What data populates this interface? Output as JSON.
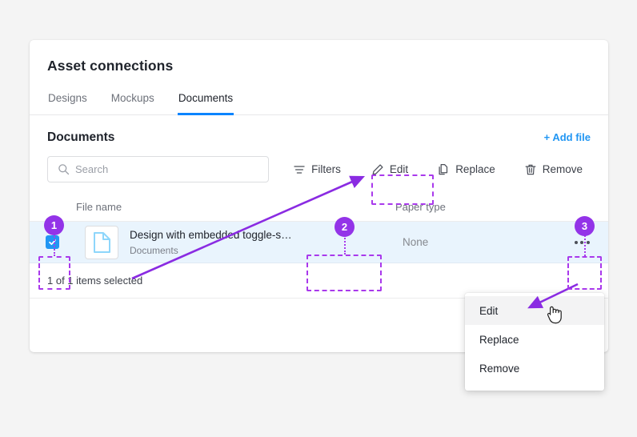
{
  "card": {
    "title": "Asset connections",
    "tabs": [
      {
        "label": "Designs",
        "active": false
      },
      {
        "label": "Mockups",
        "active": false
      },
      {
        "label": "Documents",
        "active": true
      }
    ],
    "section_title": "Documents",
    "add_file_label": "+ Add file"
  },
  "toolbar": {
    "search_placeholder": "Search",
    "search_value": "",
    "search_icon": "search-icon",
    "filters_label": "Filters",
    "filters_icon": "filter-icon",
    "edit_label": "Edit",
    "edit_icon": "pencil-icon",
    "replace_label": "Replace",
    "replace_icon": "copy-icon",
    "remove_label": "Remove",
    "remove_icon": "trash-icon"
  },
  "table": {
    "columns": {
      "file_name": "File name",
      "paper_type": "Paper type"
    },
    "rows": [
      {
        "selected": true,
        "file_icon": "document-file-icon",
        "name": "Design with embedded toggle-s…",
        "category": "Documents",
        "paper_type": "None",
        "more_icon": "more-horizontal-icon"
      }
    ],
    "footer": "1 of 1 items selected"
  },
  "context_menu": {
    "items": [
      {
        "label": "Edit",
        "hovered": true
      },
      {
        "label": "Replace",
        "hovered": false
      },
      {
        "label": "Remove",
        "hovered": false
      }
    ]
  },
  "annotations": {
    "badges": [
      {
        "number": "1"
      },
      {
        "number": "2"
      },
      {
        "number": "3"
      }
    ],
    "accent_color": "#9333e8",
    "highlight_color": "#a939ec"
  },
  "colors": {
    "page_background": "#f4f4f4",
    "card_background": "#ffffff",
    "tab_active": "#0b84fe",
    "link": "#2196f3",
    "checkbox": "#2196f3",
    "row_highlight": "#e9f4fd",
    "file_icon": "#8ed6fb"
  },
  "cursor": {
    "icon": "hand-pointer-cursor"
  }
}
